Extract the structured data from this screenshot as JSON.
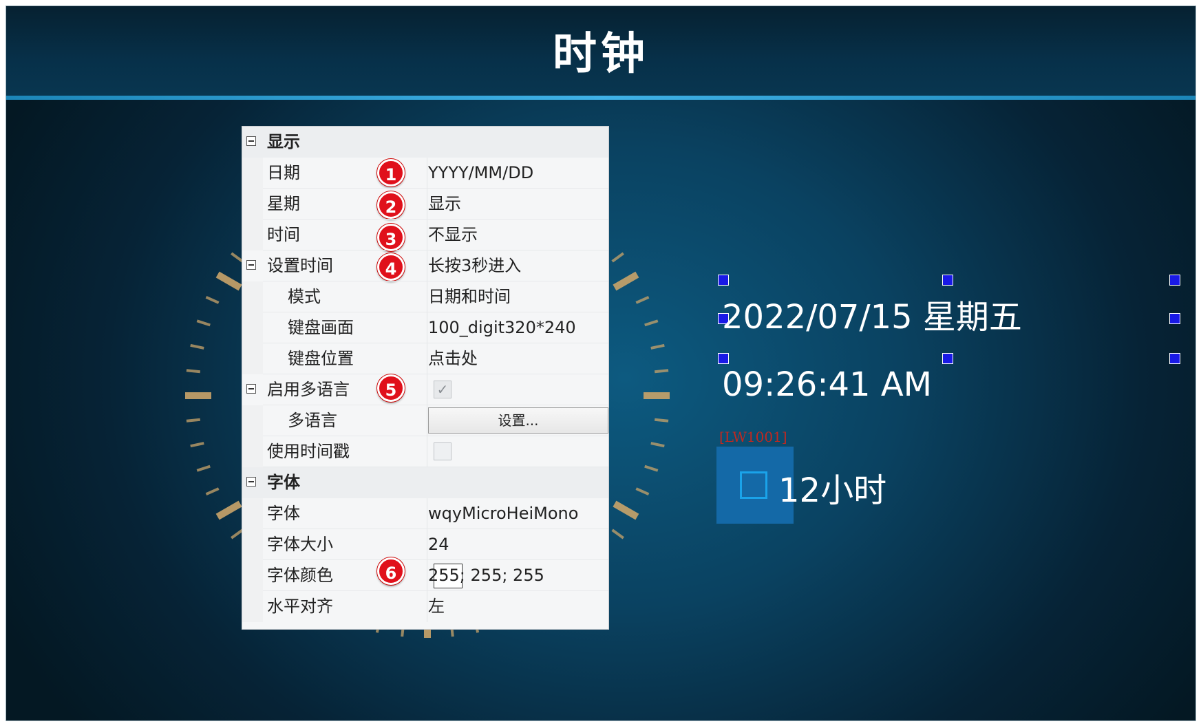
{
  "header": {
    "title": "时钟"
  },
  "properties": {
    "display": {
      "category": "显示",
      "date": {
        "label": "日期",
        "value": "YYYY/MM/DD",
        "badge": "1"
      },
      "week": {
        "label": "星期",
        "value": "显示",
        "badge": "2"
      },
      "time": {
        "label": "时间",
        "value": "不显示",
        "badge": "3"
      }
    },
    "set_time": {
      "label": "设置时间",
      "value": "长按3秒进入",
      "badge": "4",
      "mode": {
        "label": "模式",
        "value": "日期和时间"
      },
      "keypad_screen": {
        "label": "键盘画面",
        "value": "100_digit320*240"
      },
      "keypad_position": {
        "label": "键盘位置",
        "value": "点击处"
      }
    },
    "multilang": {
      "label": "启用多语言",
      "badge": "5",
      "checked": true,
      "check_glyph": "✓",
      "sub": {
        "label": "多语言",
        "button": "设置..."
      }
    },
    "timestamp": {
      "label": "使用时间戳",
      "checked": false
    },
    "font": {
      "category": "字体",
      "family": {
        "label": "字体",
        "value": "wqyMicroHeiMono"
      },
      "size": {
        "label": "字体大小",
        "value": "24"
      },
      "color": {
        "label": "字体颜色",
        "value": "255; 255; 255",
        "badge": "6",
        "swatch": "#ffffff"
      },
      "align": {
        "label": "水平对齐",
        "value": "左"
      }
    }
  },
  "preview": {
    "date_text": "2022/07/15 星期五",
    "time_text": "09:26:41 AM",
    "address_label": "[LW1001]",
    "hour12_label": "12小时"
  },
  "colors": {
    "background": "#0a4261",
    "title_line": "#3fb1e6",
    "badge": "#e0101b",
    "handle": "#1919e6",
    "tick": "#c9a46a"
  }
}
